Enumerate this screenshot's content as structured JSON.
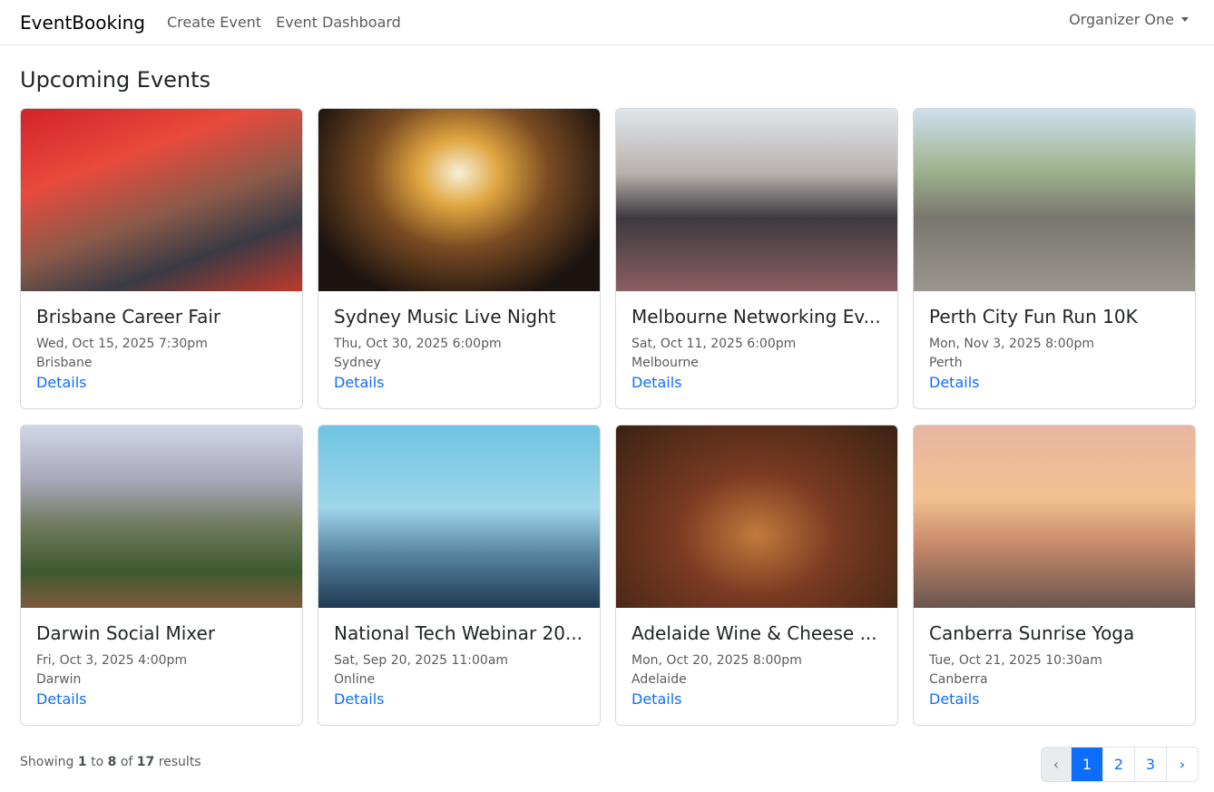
{
  "nav": {
    "brand": "EventBooking",
    "links": [
      "Create Event",
      "Event Dashboard"
    ],
    "user": "Organizer One"
  },
  "heading": "Upcoming Events",
  "events": [
    {
      "title": "Brisbane Career Fair",
      "date": "Wed, Oct 15, 2025 7:30pm",
      "location": "Brisbane",
      "link": "Details"
    },
    {
      "title": "Sydney Music Live Night",
      "date": "Thu, Oct 30, 2025 6:00pm",
      "location": "Sydney",
      "link": "Details"
    },
    {
      "title": "Melbourne Networking Ev...",
      "date": "Sat, Oct 11, 2025 6:00pm",
      "location": "Melbourne",
      "link": "Details"
    },
    {
      "title": "Perth City Fun Run 10K",
      "date": "Mon, Nov 3, 2025 8:00pm",
      "location": "Perth",
      "link": "Details"
    },
    {
      "title": "Darwin Social Mixer",
      "date": "Fri, Oct 3, 2025 4:00pm",
      "location": "Darwin",
      "link": "Details"
    },
    {
      "title": "National Tech Webinar 20...",
      "date": "Sat, Sep 20, 2025 11:00am",
      "location": "Online",
      "link": "Details"
    },
    {
      "title": "Adelaide Wine & Cheese ...",
      "date": "Mon, Oct 20, 2025 8:00pm",
      "location": "Adelaide",
      "link": "Details"
    },
    {
      "title": "Canberra Sunrise Yoga",
      "date": "Tue, Oct 21, 2025 10:30am",
      "location": "Canberra",
      "link": "Details"
    }
  ],
  "results": {
    "prefix": "Showing",
    "from": "1",
    "to_word": "to",
    "to": "8",
    "of_word": "of",
    "total": "17",
    "suffix": "results"
  },
  "pagination": {
    "prev": "‹",
    "pages": [
      "1",
      "2",
      "3"
    ],
    "next": "›",
    "active": "1"
  },
  "colors": {
    "accent": "#0d6efd"
  }
}
